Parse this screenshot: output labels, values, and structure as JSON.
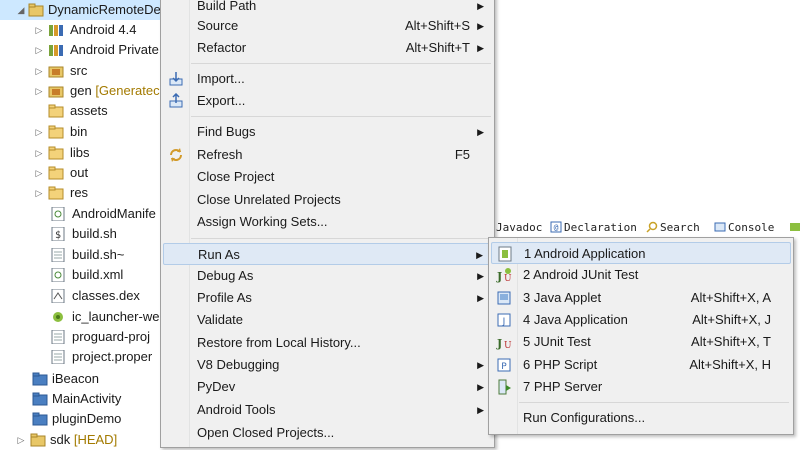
{
  "tree": {
    "items": [
      {
        "label": "DynamicRemoteDe",
        "gen": ""
      },
      {
        "label": "Android 4.4",
        "gen": ""
      },
      {
        "label": "Android Private",
        "gen": ""
      },
      {
        "label": "src",
        "gen": ""
      },
      {
        "label": "gen ",
        "gen": "[Generatec"
      },
      {
        "label": "assets",
        "gen": ""
      },
      {
        "label": "bin",
        "gen": ""
      },
      {
        "label": "libs",
        "gen": ""
      },
      {
        "label": "out",
        "gen": ""
      },
      {
        "label": "res",
        "gen": ""
      },
      {
        "label": "AndroidManife",
        "gen": ""
      },
      {
        "label": "build.sh",
        "gen": ""
      },
      {
        "label": "build.sh~",
        "gen": ""
      },
      {
        "label": "build.xml",
        "gen": ""
      },
      {
        "label": "classes.dex",
        "gen": ""
      },
      {
        "label": "ic_launcher-wel",
        "gen": ""
      },
      {
        "label": "proguard-proj",
        "gen": ""
      },
      {
        "label": "project.proper",
        "gen": ""
      },
      {
        "label": "iBeacon",
        "gen": ""
      },
      {
        "label": "MainActivity",
        "gen": ""
      },
      {
        "label": "pluginDemo",
        "gen": ""
      },
      {
        "label": "sdk ",
        "gen": "[HEAD]"
      }
    ]
  },
  "tabs": [
    "Javadoc",
    "Declaration",
    "Search",
    "Console"
  ],
  "context_menu": {
    "items": [
      {
        "label": "Build Path",
        "accel": "",
        "submenu": true
      },
      {
        "label": "Source",
        "accel": "Alt+Shift+S",
        "submenu": true
      },
      {
        "label": "Refactor",
        "accel": "Alt+Shift+T",
        "submenu": true
      },
      {
        "label": "Import...",
        "accel": "",
        "submenu": false,
        "icon": "import-icon"
      },
      {
        "label": "Export...",
        "accel": "",
        "submenu": false,
        "icon": "export-icon"
      },
      {
        "label": "Find Bugs",
        "accel": "",
        "submenu": true
      },
      {
        "label": "Refresh",
        "accel": "F5",
        "submenu": false,
        "icon": "refresh-icon"
      },
      {
        "label": "Close Project",
        "accel": "",
        "submenu": false
      },
      {
        "label": "Close Unrelated Projects",
        "accel": "",
        "submenu": false
      },
      {
        "label": "Assign Working Sets...",
        "accel": "",
        "submenu": false
      },
      {
        "label": "Run As",
        "accel": "",
        "submenu": true,
        "highlighted": true
      },
      {
        "label": "Debug As",
        "accel": "",
        "submenu": true
      },
      {
        "label": "Profile As",
        "accel": "",
        "submenu": true
      },
      {
        "label": "Validate",
        "accel": "",
        "submenu": false
      },
      {
        "label": "Restore from Local History...",
        "accel": "",
        "submenu": false
      },
      {
        "label": "V8 Debugging",
        "accel": "",
        "submenu": true
      },
      {
        "label": "PyDev",
        "accel": "",
        "submenu": true
      },
      {
        "label": "Android Tools",
        "accel": "",
        "submenu": true
      },
      {
        "label": "Open Closed Projects...",
        "accel": "",
        "submenu": false
      }
    ]
  },
  "run_as_submenu": {
    "items": [
      {
        "label": "1 Android Application",
        "accel": "",
        "icon": "android-app-icon",
        "highlighted": true
      },
      {
        "label": "2 Android JUnit Test",
        "accel": "",
        "icon": "android-junit-icon"
      },
      {
        "label": "3 Java Applet",
        "accel": "Alt+Shift+X, A",
        "icon": "java-applet-icon"
      },
      {
        "label": "4 Java Application",
        "accel": "Alt+Shift+X, J",
        "icon": "java-app-icon"
      },
      {
        "label": "5 JUnit Test",
        "accel": "Alt+Shift+X, T",
        "icon": "junit-icon"
      },
      {
        "label": "6 PHP Script",
        "accel": "Alt+Shift+X, H",
        "icon": "php-script-icon"
      },
      {
        "label": "7 PHP Server",
        "accel": "",
        "icon": "php-server-icon"
      },
      {
        "label": "Run Configurations...",
        "accel": ""
      }
    ]
  },
  "colors": {
    "accent": "#dfe9f5",
    "menu_bg": "#f0f0f0",
    "selection": "#cde8ff"
  }
}
